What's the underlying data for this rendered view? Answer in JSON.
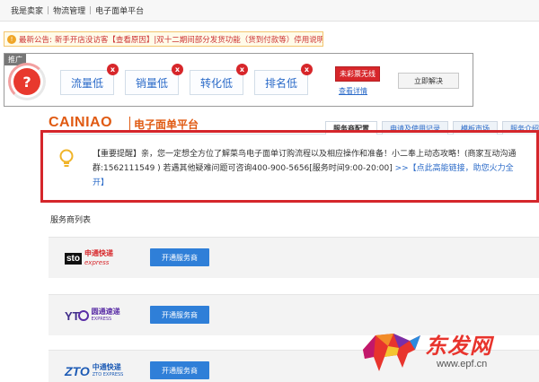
{
  "breadcrumb": [
    "我是卖家",
    "物流管理",
    "电子面单平台"
  ],
  "notice": {
    "label": "最新公告:",
    "content": "新手开店没访客【查看原因】|双十二期间部分发货功能（货到付款等）停用说明"
  },
  "promo": {
    "tag": "推广",
    "gauge_symbol": "?",
    "metrics": [
      {
        "label": "流量低"
      },
      {
        "label": "销量低"
      },
      {
        "label": "转化低"
      },
      {
        "label": "排名低"
      }
    ],
    "metric_badge": "x",
    "warning_badge": "未彩票无线",
    "detail_link": "查看详情",
    "solve_button": "立即解决"
  },
  "header": {
    "logo": "CAINIAO",
    "platform": "电子面单平台"
  },
  "tabs": [
    {
      "label": "服务商配置",
      "active": true
    },
    {
      "label": "申请及使用记录",
      "active": false
    },
    {
      "label": "模板市场",
      "active": false
    },
    {
      "label": "服务介绍",
      "active": false
    }
  ],
  "hint": {
    "line1": "【重要提醒】亲，您一定想全方位了解菜鸟电子面单订购流程以及相应操作和准备！小二奉上动态攻略！(商家互动沟通",
    "line2": "群:1562111549 ) 若遇其他疑难问题可咨询400-900-5656[服务时间9:00-20:00]",
    "line2_link": " >>【点此高能链接，助您火力全",
    "line3": "开】"
  },
  "section_title": "服务商列表",
  "providers": [
    {
      "logo_mark": "sto",
      "logo_cn": "申通快递",
      "logo_en": "express",
      "button": "开通服务商"
    },
    {
      "logo_mark": "YT",
      "logo_cn": "圆通速递",
      "logo_en": "EXPRESS",
      "button": "开通服务商"
    },
    {
      "logo_mark": "ZTO",
      "logo_cn": "中通快递",
      "logo_en": "ZTO EXPRESS",
      "button": "开通服务商"
    }
  ],
  "watermark": {
    "cn": "东发网",
    "url": "www.epf.cn"
  },
  "colors": {
    "accent_blue": "#2f7fd8",
    "alert_red": "#d5262b",
    "brand_orange": "#e05a12"
  },
  "icons": {
    "notice": "announcement-icon",
    "hint": "lightbulb-icon"
  }
}
